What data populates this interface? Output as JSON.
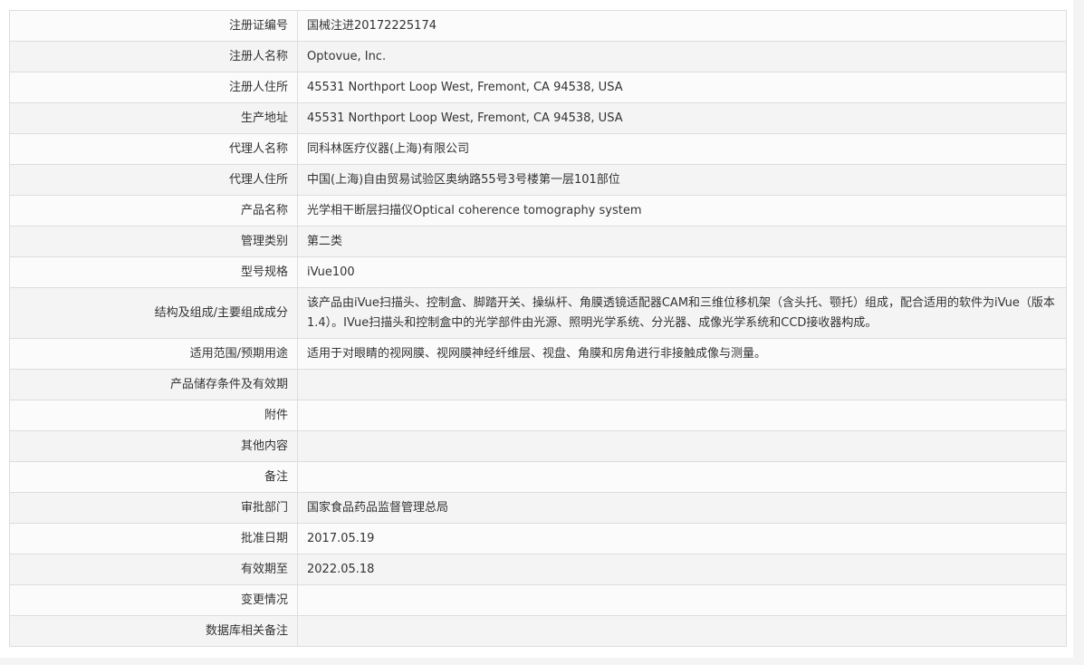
{
  "rows": [
    {
      "label": "注册证编号",
      "value": "国械注进20172225174"
    },
    {
      "label": "注册人名称",
      "value": "Optovue, Inc."
    },
    {
      "label": "注册人住所",
      "value": "45531 Northport Loop West, Fremont, CA 94538, USA"
    },
    {
      "label": "生产地址",
      "value": "45531 Northport Loop West, Fremont, CA 94538, USA"
    },
    {
      "label": "代理人名称",
      "value": "同科林医疗仪器(上海)有限公司"
    },
    {
      "label": "代理人住所",
      "value": "中国(上海)自由贸易试验区奥纳路55号3号楼第一层101部位"
    },
    {
      "label": "产品名称",
      "value": "光学相干断层扫描仪Optical coherence tomography system"
    },
    {
      "label": "管理类别",
      "value": "第二类"
    },
    {
      "label": "型号规格",
      "value": "iVue100"
    },
    {
      "label": "结构及组成/主要组成成分",
      "value": "该产品由iVue扫描头、控制盒、脚踏开关、操纵杆、角膜透镜适配器CAM和三维位移机架（含头托、颚托）组成，配合适用的软件为iVue（版本1.4）。IVue扫描头和控制盒中的光学部件由光源、照明光学系统、分光器、成像光学系统和CCD接收器构成。"
    },
    {
      "label": "适用范围/预期用途",
      "value": "适用于对眼睛的视网膜、视网膜神经纤维层、视盘、角膜和房角进行非接触成像与测量。"
    },
    {
      "label": "产品储存条件及有效期",
      "value": ""
    },
    {
      "label": "附件",
      "value": ""
    },
    {
      "label": "其他内容",
      "value": ""
    },
    {
      "label": "备注",
      "value": ""
    },
    {
      "label": "审批部门",
      "value": "国家食品药品监督管理总局"
    },
    {
      "label": "批准日期",
      "value": "2017.05.19"
    },
    {
      "label": "有效期至",
      "value": "2022.05.18"
    },
    {
      "label": "变更情况",
      "value": ""
    },
    {
      "label": "数据库相关备注",
      "value": ""
    }
  ]
}
